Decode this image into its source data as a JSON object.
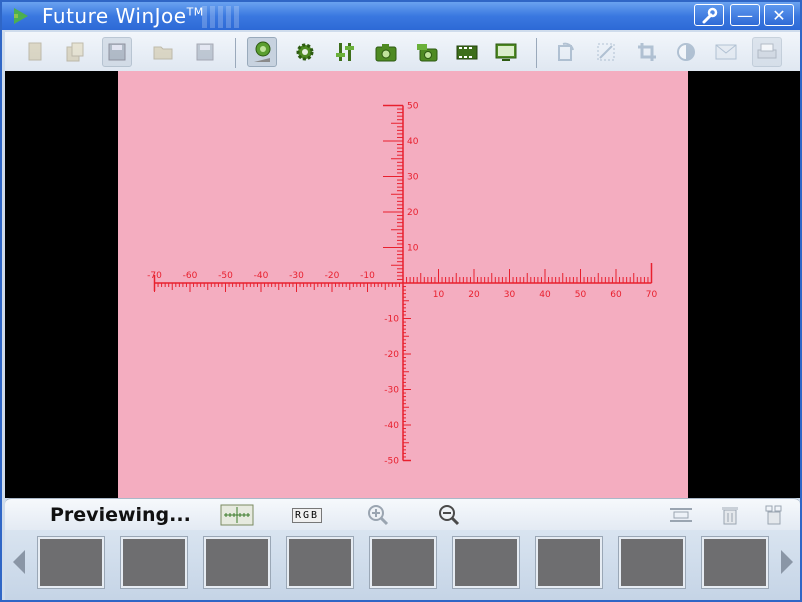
{
  "window": {
    "title": "Future WinJoe",
    "trademark": "TM"
  },
  "titlebar": {
    "settings_icon": "wrench-icon",
    "minimize_label": "—",
    "close_label": "✕"
  },
  "toolbar": {
    "groups": [
      [
        "new-file-icon",
        "copy-file-icon",
        "save-as-icon",
        "open-folder-icon",
        "save-icon"
      ],
      [
        "webcam-icon",
        "gear-icon",
        "adjust-sliders-icon",
        "camera-icon",
        "burst-camera-icon",
        "film-icon",
        "monitor-icon"
      ],
      [
        "rotate-icon",
        "resize-icon",
        "crop-icon",
        "contrast-icon",
        "mail-icon",
        "printer-icon"
      ]
    ]
  },
  "reticle": {
    "x_labels": [
      "-70",
      "-60",
      "-50",
      "-40",
      "-30",
      "-20",
      "-10",
      "10",
      "20",
      "30",
      "40",
      "50",
      "60",
      "70"
    ],
    "y_labels_up": [
      "50",
      "40",
      "30",
      "20",
      "10"
    ],
    "y_labels_down": [
      "-10",
      "-20",
      "-30",
      "-40",
      "-50"
    ],
    "color": "#e8202e"
  },
  "status": {
    "text": "Previewing..."
  },
  "statusbar_buttons": {
    "rgb_label": "RGB",
    "icons": [
      "scale-ruler-icon",
      "rgb-channel-icon",
      "zoom-in-icon",
      "zoom-out-icon",
      "fit-width-icon",
      "trash-icon",
      "delete-all-icon"
    ]
  },
  "filmstrip": {
    "thumb_count": 9
  },
  "colors": {
    "titlebar": "#3a78e0",
    "preview_bg": "#f4adc0",
    "reticle": "#e8202e",
    "thumb": "#6e6e70"
  }
}
